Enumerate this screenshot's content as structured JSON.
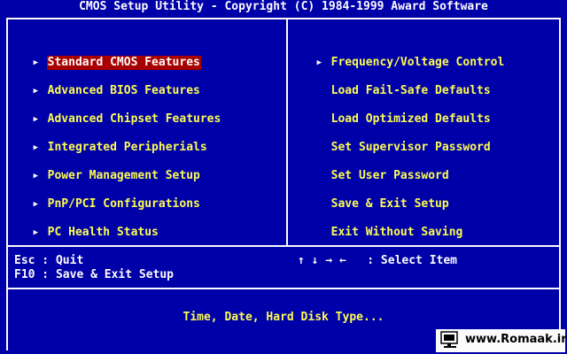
{
  "title": "CMOS Setup Utility - Copyright (C) 1984-1999 Award Software",
  "left_menu": [
    {
      "label": "Standard CMOS Features",
      "has_submenu": true,
      "selected": true
    },
    {
      "label": "Advanced BIOS Features",
      "has_submenu": true,
      "selected": false
    },
    {
      "label": "Advanced Chipset Features",
      "has_submenu": true,
      "selected": false
    },
    {
      "label": "Integrated Peripherials",
      "has_submenu": true,
      "selected": false
    },
    {
      "label": "Power Management Setup",
      "has_submenu": true,
      "selected": false
    },
    {
      "label": "PnP/PCI Configurations",
      "has_submenu": true,
      "selected": false
    },
    {
      "label": "PC Health Status",
      "has_submenu": true,
      "selected": false
    }
  ],
  "right_menu": [
    {
      "label": "Frequency/Voltage Control",
      "has_submenu": true,
      "selected": false
    },
    {
      "label": "Load Fail-Safe Defaults",
      "has_submenu": false,
      "selected": false
    },
    {
      "label": "Load Optimized Defaults",
      "has_submenu": false,
      "selected": false
    },
    {
      "label": "Set Supervisor Password",
      "has_submenu": false,
      "selected": false
    },
    {
      "label": "Set User Password",
      "has_submenu": false,
      "selected": false
    },
    {
      "label": "Save & Exit Setup",
      "has_submenu": false,
      "selected": false
    },
    {
      "label": "Exit Without Saving",
      "has_submenu": false,
      "selected": false
    }
  ],
  "help": {
    "esc": "Esc : Quit",
    "f10": "F10 : Save & Exit Setup",
    "arrows": "↑ ↓ → ←   : Select Item"
  },
  "description": "Time, Date, Hard Disk Type...",
  "watermark": {
    "text": "www.Romaak.ir",
    "icon": "computer-monitor-icon"
  },
  "colors": {
    "background": "#0000a8",
    "menu_text": "#fcfc54",
    "highlight_bg": "#a80000",
    "highlight_text": "#fcfcfc",
    "frame": "#fcfcfc"
  }
}
